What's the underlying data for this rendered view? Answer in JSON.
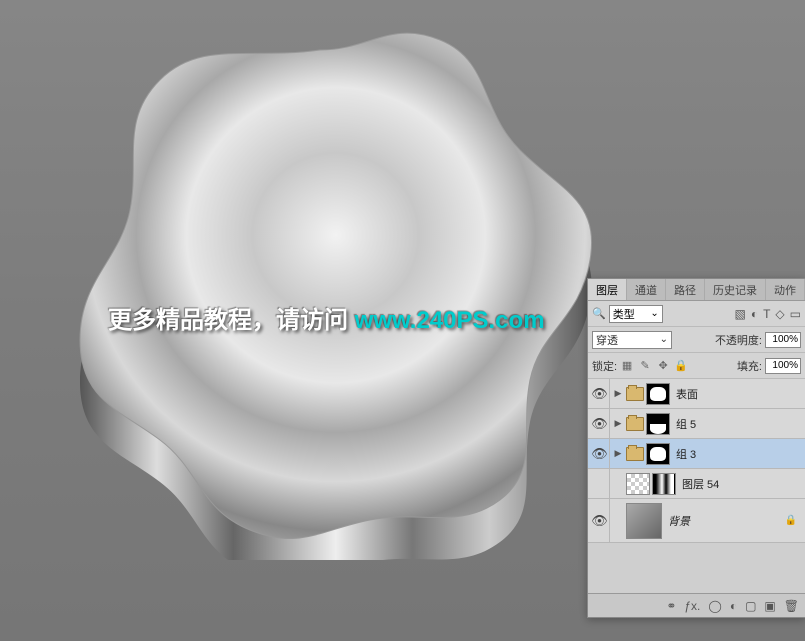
{
  "watermark": {
    "text": "更多精品教程，请访问 ",
    "url": "www.240PS.com"
  },
  "panel": {
    "tabs": [
      "图层",
      "通道",
      "路径",
      "历史记录",
      "动作"
    ],
    "active_tab_index": 0,
    "filter_dropdown": "类型",
    "blend_mode": "穿透",
    "opacity_label": "不透明度:",
    "opacity_value": "100%",
    "lock_label": "锁定:",
    "fill_label": "填充:",
    "fill_value": "100%",
    "layers": [
      {
        "visible": true,
        "type": "group",
        "expand": "▶",
        "mask": "shape",
        "name": "表面"
      },
      {
        "visible": true,
        "type": "group",
        "expand": "▶",
        "mask": "bottom",
        "name": "组 5"
      },
      {
        "visible": true,
        "type": "group",
        "expand": "▶",
        "mask": "shape",
        "name": "组 3",
        "selected": true
      },
      {
        "visible": false,
        "type": "layer",
        "expand": "",
        "name": "图层 54"
      },
      {
        "visible": true,
        "type": "bg",
        "expand": "",
        "name": "背景",
        "locked": true
      }
    ]
  }
}
